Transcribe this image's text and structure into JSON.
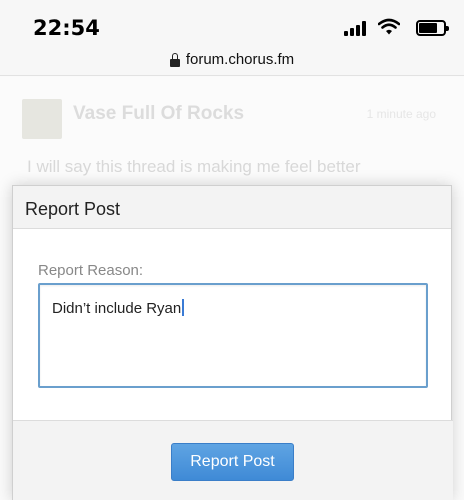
{
  "status_bar": {
    "time": "22:54"
  },
  "browser": {
    "url": "forum.chorus.fm"
  },
  "background_post": {
    "author": "Vase Full Of Rocks",
    "time": "1 minute ago",
    "text": "I will say this thread is making me feel better"
  },
  "modal": {
    "title": "Report Post",
    "field_label": "Report Reason:",
    "field_value": "Didn’t include Ryan",
    "submit_label": "Report Post"
  },
  "colors": {
    "button": "#4a92dc",
    "input_focus_border": "#6a9fcd"
  }
}
